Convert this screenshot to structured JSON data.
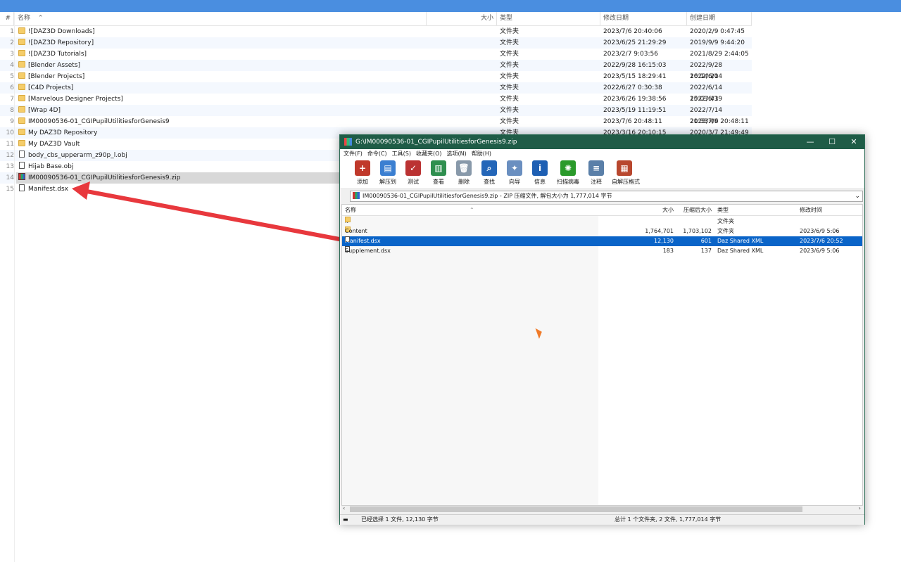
{
  "explorer": {
    "header": {
      "idx": "#",
      "name": "名称",
      "size": "大小",
      "type": "类型",
      "modified": "修改日期",
      "created": "创建日期"
    },
    "rows": [
      {
        "idx": "1",
        "name": "![DAZ3D Downloads]",
        "type": "文件夹",
        "modified": "2023/7/6 20:40:06",
        "created": "2020/2/9 0:47:45",
        "icon": "folder-icon"
      },
      {
        "idx": "2",
        "name": "![DAZ3D Repository]",
        "type": "文件夹",
        "modified": "2023/6/25 21:29:29",
        "created": "2019/9/9 9:44:20",
        "icon": "folder-icon"
      },
      {
        "idx": "3",
        "name": "![DAZ3D Tutorials]",
        "type": "文件夹",
        "modified": "2023/2/7 9:03:56",
        "created": "2021/8/29 2:44:05",
        "icon": "folder-icon"
      },
      {
        "idx": "4",
        "name": "[Blender Assets]",
        "type": "文件夹",
        "modified": "2022/9/28 16:15:03",
        "created": "2022/9/28 16:14:20",
        "icon": "folder-icon"
      },
      {
        "idx": "5",
        "name": "[Blender Projects]",
        "type": "文件夹",
        "modified": "2023/5/15 18:29:41",
        "created": "2022/6/14 14:17:50",
        "icon": "folder-icon"
      },
      {
        "idx": "6",
        "name": "[C4D Projects]",
        "type": "文件夹",
        "modified": "2022/6/27 0:30:38",
        "created": "2022/6/14 15:03:43",
        "icon": "folder-icon"
      },
      {
        "idx": "7",
        "name": "[Marvelous Designer Projects]",
        "type": "文件夹",
        "modified": "2023/6/26 19:38:56",
        "created": "2022/6/19 14:28:39",
        "icon": "folder-icon"
      },
      {
        "idx": "8",
        "name": "[Wrap 4D]",
        "type": "文件夹",
        "modified": "2023/5/19 11:19:51",
        "created": "2022/7/14 21:33:49",
        "icon": "folder-icon"
      },
      {
        "idx": "9",
        "name": "IM00090536-01_CGIPupilUtilitiesforGenesis9",
        "type": "文件夹",
        "modified": "2023/7/6 20:48:11",
        "created": "2023/7/6 20:48:11",
        "icon": "folder-icon"
      },
      {
        "idx": "10",
        "name": "My DAZ3D Repository",
        "type": "文件夹",
        "modified": "2023/3/16 20:10:15",
        "created": "2020/3/7 21:49:49",
        "icon": "folder-icon"
      },
      {
        "idx": "11",
        "name": "My DAZ3D Vault",
        "type": "",
        "modified": "",
        "created": "",
        "icon": "folder-icon"
      },
      {
        "idx": "12",
        "name": "body_cbs_upperarm_z90p_l.obj",
        "type": "",
        "modified": "",
        "created": "",
        "icon": "file-icon"
      },
      {
        "idx": "13",
        "name": "Hijab Base.obj",
        "type": "",
        "modified": "",
        "created": "",
        "icon": "file-icon"
      },
      {
        "idx": "14",
        "name": "IM00090536-01_CGIPupilUtilitiesforGenesis9.zip",
        "type": "",
        "modified": "",
        "created": "",
        "icon": "zip-icon"
      },
      {
        "idx": "15",
        "name": "Manifest.dsx",
        "type": "",
        "modified": "",
        "created": "",
        "icon": "file-icon"
      }
    ]
  },
  "winrar": {
    "title": "G:\\IM00090536-01_CGIPupilUtilitiesforGenesis9.zip",
    "window_buttons": {
      "minimize": "—",
      "maximize": "☐",
      "close": "✕"
    },
    "menu": [
      "文件(F)",
      "命令(C)",
      "工具(S)",
      "收藏夹(O)",
      "选项(N)",
      "帮助(H)"
    ],
    "toolbar": [
      {
        "label": "添加",
        "icon": "add-icon",
        "color": "#c0392b",
        "glyph": "+"
      },
      {
        "label": "解压到",
        "icon": "extract-icon",
        "color": "#3b7fd1",
        "glyph": "▤"
      },
      {
        "label": "测试",
        "icon": "test-icon",
        "color": "#b33",
        "glyph": "✓"
      },
      {
        "label": "查看",
        "icon": "view-icon",
        "color": "#2f8f4f",
        "glyph": "▥"
      },
      {
        "label": "删除",
        "icon": "delete-icon",
        "color": "#8899aa",
        "glyph": "🗑"
      },
      {
        "label": "查找",
        "icon": "find-icon",
        "color": "#2466b8",
        "glyph": "⌕"
      },
      {
        "label": "向导",
        "icon": "wizard-icon",
        "color": "#6a8fc0",
        "glyph": "✦"
      },
      {
        "label": "信息",
        "icon": "info-icon",
        "color": "#1e5fb3",
        "glyph": "i"
      },
      {
        "label": "扫描病毒",
        "icon": "virus-scan-icon",
        "color": "#2a9a2a",
        "glyph": "✺"
      },
      {
        "label": "注释",
        "icon": "comment-icon",
        "color": "#5a7fa8",
        "glyph": "≡"
      },
      {
        "label": "自解压格式",
        "icon": "sfx-icon",
        "color": "#b8472e",
        "glyph": "▦"
      }
    ],
    "path_text": "IM00090536-01_CGIPupilUtilitiesforGenesis9.zip - ZIP 压缩文件, 解包大小为 1,777,014 字节",
    "list_header": {
      "name": "名称",
      "size": "大小",
      "packed": "压缩后大小",
      "type": "类型",
      "modified": "修改时间"
    },
    "files": [
      {
        "name": "..",
        "size": "",
        "packed": "",
        "type": "文件夹",
        "modified": "",
        "kind": "folder"
      },
      {
        "name": "Content",
        "size": "1,764,701",
        "packed": "1,703,102",
        "type": "文件夹",
        "modified": "2023/6/9 5:06",
        "kind": "folder"
      },
      {
        "name": "Manifest.dsx",
        "size": "12,130",
        "packed": "601",
        "type": "Daz Shared XML",
        "modified": "2023/7/6 20:52",
        "kind": "doc",
        "selected": true
      },
      {
        "name": "Supplement.dsx",
        "size": "183",
        "packed": "137",
        "type": "Daz Shared XML",
        "modified": "2023/6/9 5:06",
        "kind": "doc"
      }
    ],
    "status_left": "已经选择 1 文件, 12,130 字节",
    "status_right": "总计 1 个文件夹, 2 文件, 1,777,014 字节"
  },
  "colors": {
    "titlebar": "#1f5c47",
    "selection": "#0a64c8",
    "arrow": "#e8383d",
    "topbar": "#4a8ee0"
  }
}
